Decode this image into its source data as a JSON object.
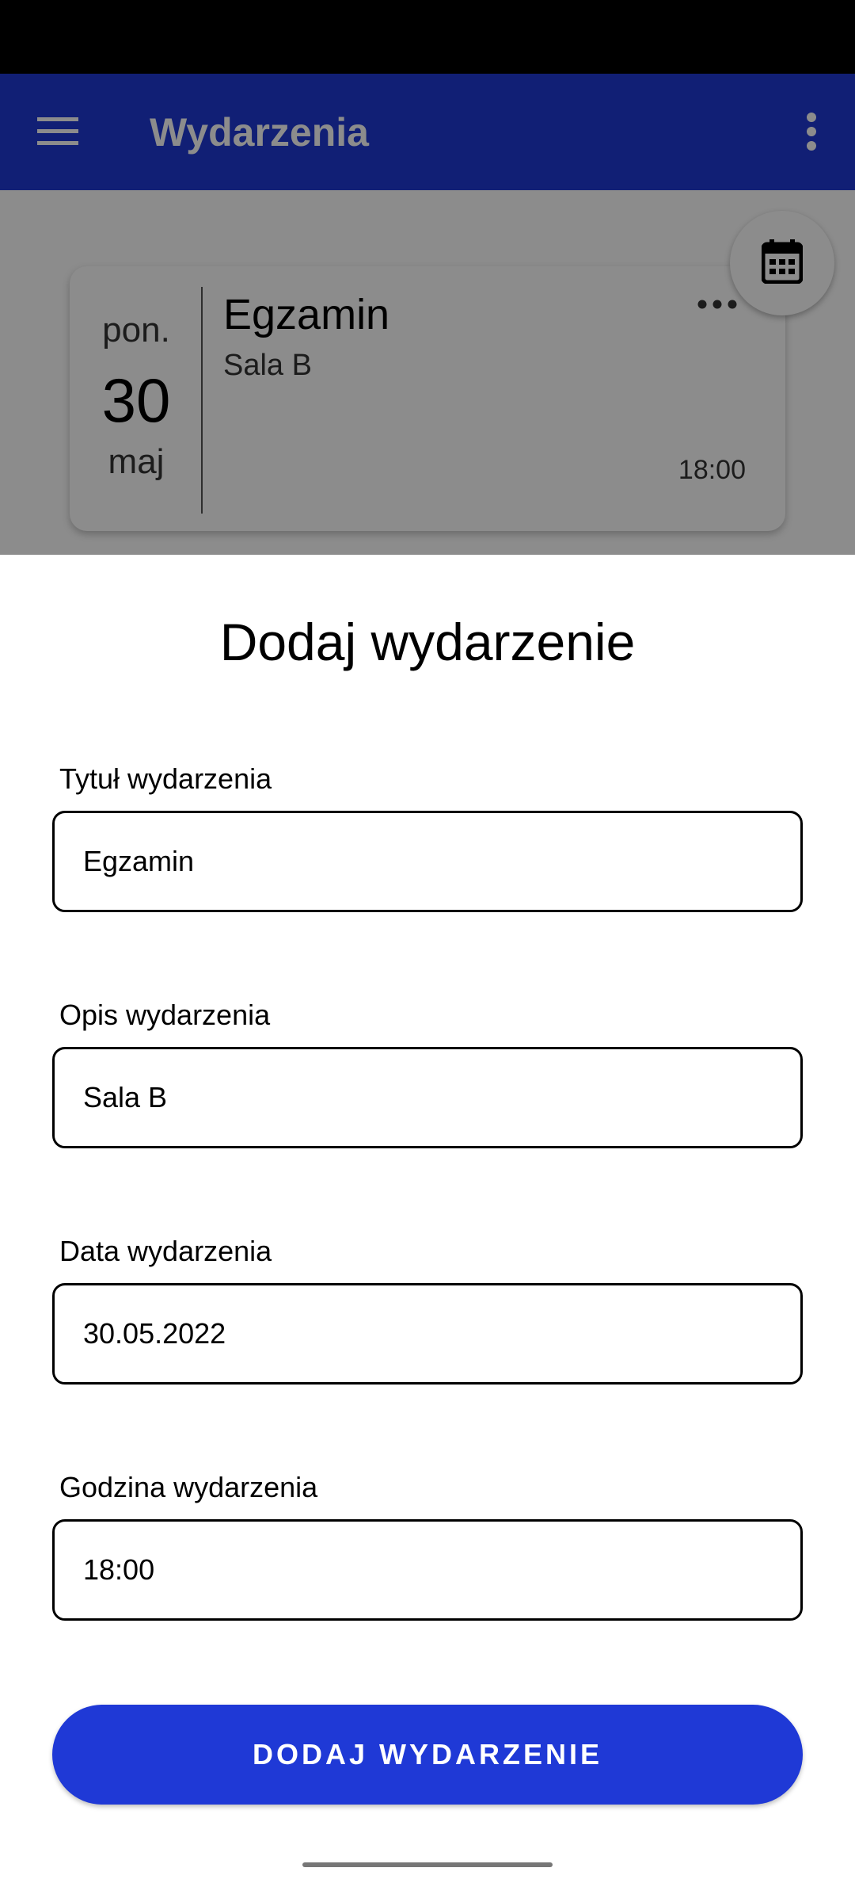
{
  "app_bar": {
    "title": "Wydarzenia",
    "menu_icon": "hamburger-menu-icon",
    "overflow_icon": "more-vert-icon",
    "color": "#1f39d6"
  },
  "event_card": {
    "day_of_week": "pon.",
    "day": "30",
    "month": "maj",
    "title": "Egzamin",
    "description": "Sala B",
    "time": "18:00",
    "more_icon": "more-horiz-icon"
  },
  "calendar_button": {
    "icon": "calendar-icon"
  },
  "form": {
    "title": "Dodaj wydarzenie",
    "fields": {
      "title": {
        "label": "Tytuł wydarzenia",
        "value": "Egzamin"
      },
      "description": {
        "label": "Opis wydarzenia",
        "value": "Sala B"
      },
      "date": {
        "label": "Data wydarzenia",
        "value": "30.05.2022"
      },
      "time": {
        "label": "Godzina wydarzenia",
        "value": "18:00"
      }
    },
    "submit_label": "DODAJ WYDARZENIE",
    "accent_color": "#1f39d6"
  }
}
